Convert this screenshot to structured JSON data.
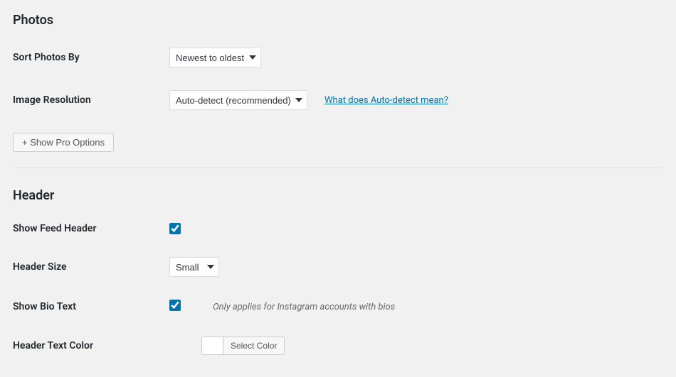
{
  "photos": {
    "section_title": "Photos",
    "sort_label": "Sort Photos By",
    "sort_selected": "Newest to oldest",
    "resolution_label": "Image Resolution",
    "resolution_selected": "Auto-detect (recommended)",
    "resolution_help_link": "What does Auto-detect mean?",
    "show_pro_button": "+ Show Pro Options"
  },
  "header": {
    "section_title": "Header",
    "show_feed_label": "Show Feed Header",
    "show_feed_checked": true,
    "size_label": "Header Size",
    "size_selected": "Small",
    "show_bio_label": "Show Bio Text",
    "show_bio_checked": true,
    "show_bio_hint": "Only applies for Instagram accounts with bios",
    "text_color_label": "Header Text Color",
    "select_color_button": "Select Color"
  }
}
